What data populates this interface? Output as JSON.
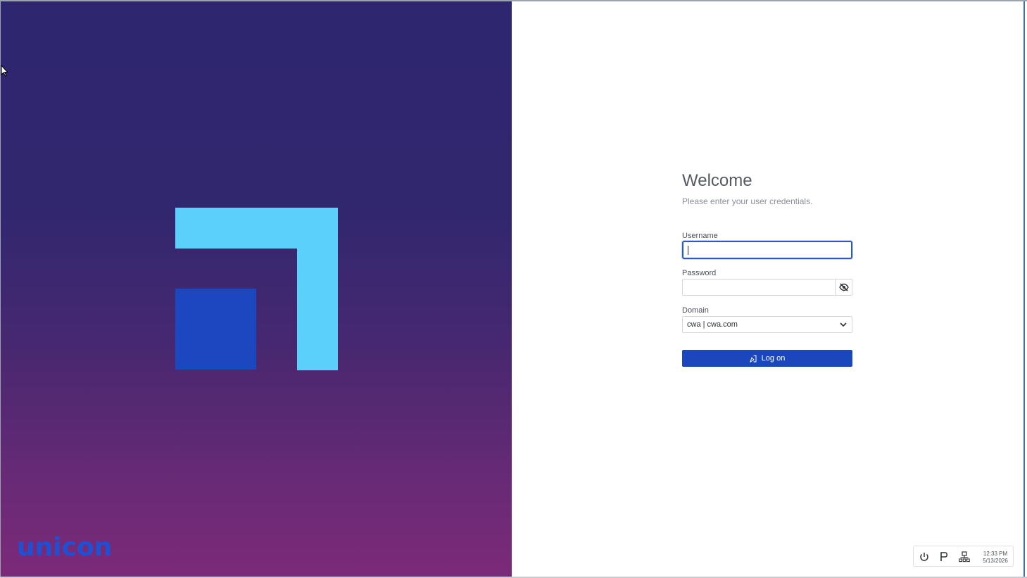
{
  "brand": {
    "name": "unicon",
    "color": "#1e50d6",
    "logo_colors": {
      "light": "#5bd0fb",
      "dark": "#1b48bf"
    }
  },
  "login": {
    "title": "Welcome",
    "subtitle": "Please enter your user credentials.",
    "username": {
      "label": "Username",
      "value": "",
      "placeholder": ""
    },
    "password": {
      "label": "Password",
      "value": "",
      "placeholder": "",
      "toggle_icon": "eye-slash-icon"
    },
    "domain": {
      "label": "Domain",
      "selected": "cwa | cwa.com"
    },
    "submit_label": "Log on",
    "accent": "#1b47bd"
  },
  "tray": {
    "icons": [
      "power-icon",
      "parking-icon",
      "network-icon"
    ],
    "time": "12:33 PM",
    "date": "5/13/2026"
  }
}
